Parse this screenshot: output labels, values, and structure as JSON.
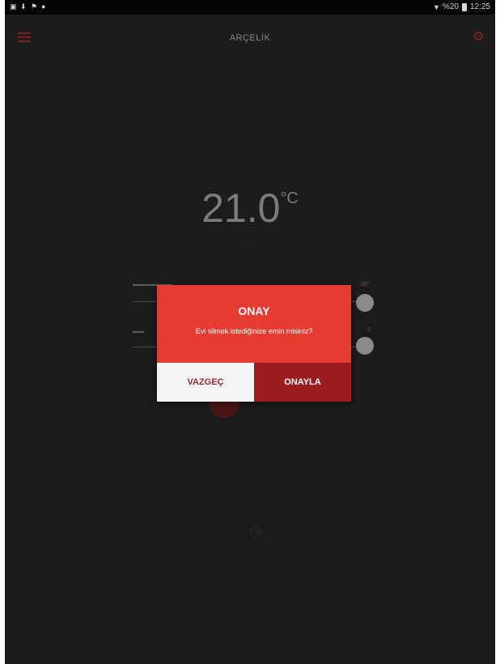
{
  "status_bar": {
    "battery_text": "%20",
    "time": "12:25"
  },
  "app_bar": {
    "title": "ARÇELİK"
  },
  "main": {
    "temperature_value": "21.0",
    "temperature_unit": "°C",
    "slider1": {
      "max_label": "30°"
    },
    "slider2": {
      "max_label": "5"
    }
  },
  "dialog": {
    "title": "ONAY",
    "message": "Evi silmek istediğinize emin misiniz?",
    "cancel_label": "VAZGEÇ",
    "confirm_label": "ONAYLA"
  },
  "colors": {
    "accent": "#e63b33",
    "accent_dark": "#9c1d20",
    "background": "#1c1c1d"
  }
}
